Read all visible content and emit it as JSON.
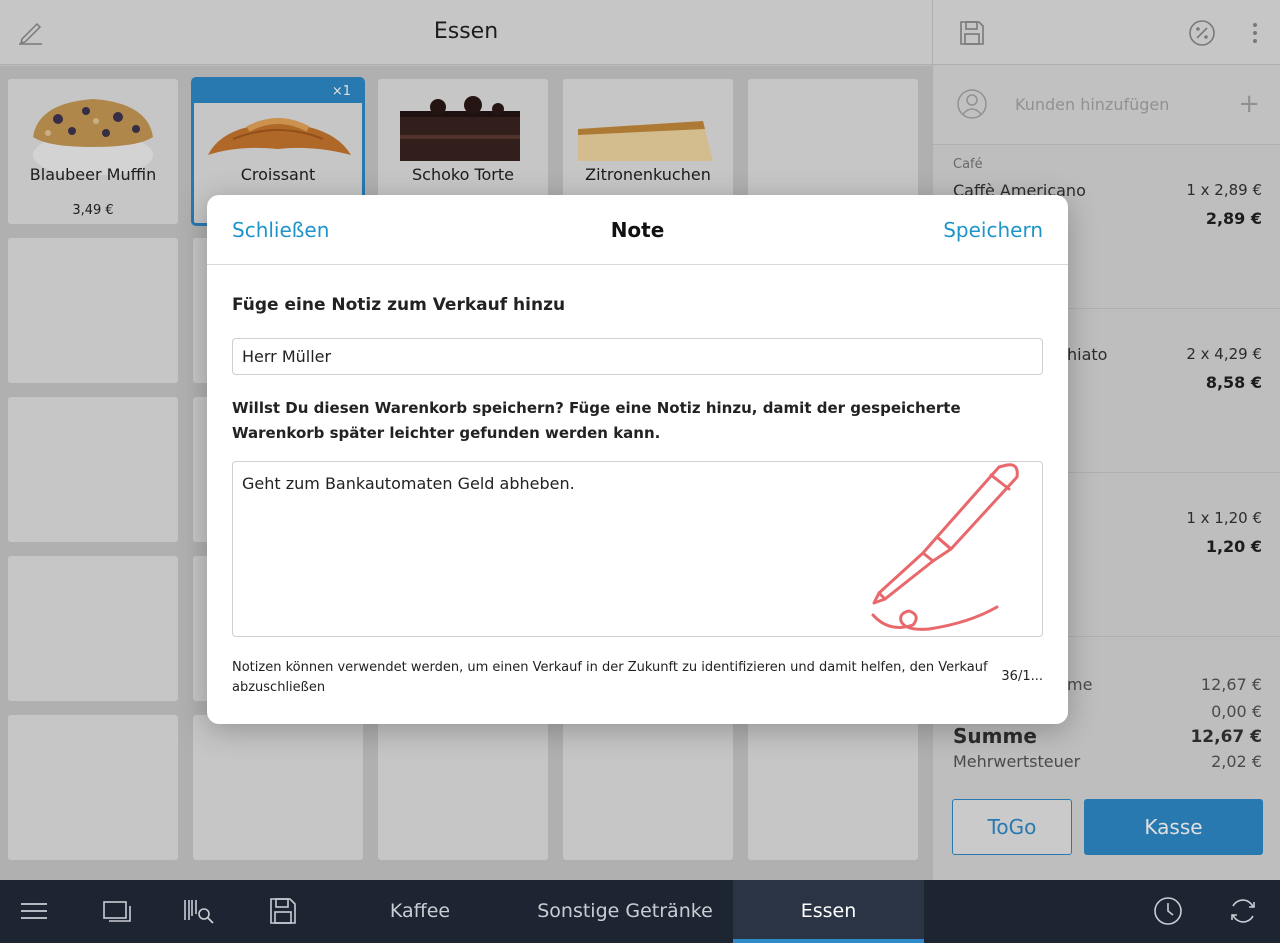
{
  "header": {
    "title": "Essen"
  },
  "products": [
    {
      "name": "Blaubeer Muffin",
      "price": "3,49 €"
    },
    {
      "name": "Croissant",
      "badge": "×1"
    },
    {
      "name": "Schoko Torte"
    },
    {
      "name": "Zitronenkuchen"
    }
  ],
  "cart": {
    "customer_label": "Kunden hinzufügen",
    "lines": [
      {
        "category": "Café",
        "product": "Caffè Americano",
        "qty": "1 x 2,89 €",
        "total": "2,89 €"
      },
      {
        "product": "hiato",
        "qty": "2 x 4,29 €",
        "total": "8,58 €"
      },
      {
        "qty": "1 x 1,20 €",
        "total": "1,20 €"
      }
    ],
    "subtotal_label": "me",
    "subtotal_value": "12,67 €",
    "discount_value": "0,00 €",
    "sum_label": "Summe",
    "sum_value": "12,67 €",
    "tax_label": "Mehrwertsteuer",
    "tax_value": "2,02 €",
    "togo_label": "ToGo",
    "kasse_label": "Kasse"
  },
  "bottom_nav": {
    "tabs": [
      "Kaffee",
      "Sonstige Getränke",
      "Essen"
    ],
    "active": "Essen"
  },
  "modal": {
    "close_label": "Schließen",
    "title": "Note",
    "save_label": "Speichern",
    "note_heading": "Füge eine Notiz zum Verkauf hinzu",
    "note_value": "Herr Müller",
    "cart_question": "Willst Du diesen Warenkorb speichern? Füge eine Notiz hinzu, damit der gespeicherte Warenkorb später leichter gefunden werden kann.",
    "textarea_value": "Geht zum Bankautomaten Geld abheben.",
    "hint": "Notizen können verwendet werden, um einen Verkauf in der Zukunft zu identifizieren und damit helfen, den Verkauf abzuschließen",
    "char_count": "36/1..."
  },
  "colors": {
    "accent": "#2e8ac9",
    "link": "#1f94c9",
    "nav_bg": "#1d2532",
    "pen": "#e8686c"
  }
}
